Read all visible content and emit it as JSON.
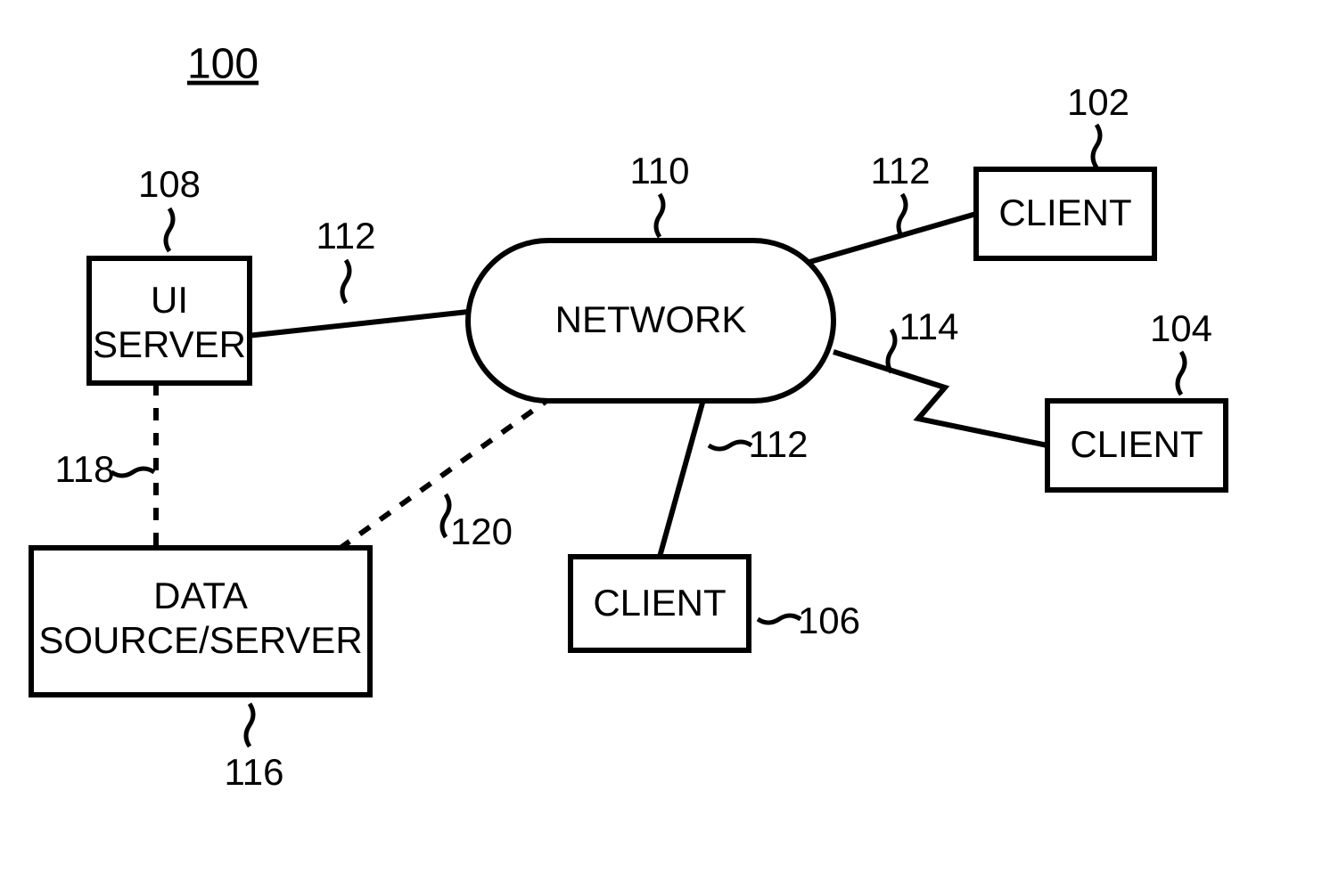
{
  "diagram": {
    "title_ref": "100",
    "network": {
      "label": "NETWORK",
      "ref": "110"
    },
    "ui_server": {
      "label_line1": "UI",
      "label_line2": "SERVER",
      "ref": "108"
    },
    "data_source": {
      "label_line1": "DATA",
      "label_line2": "SOURCE/SERVER",
      "ref": "116"
    },
    "client_top": {
      "label": "CLIENT",
      "ref": "102"
    },
    "client_right": {
      "label": "CLIENT",
      "ref": "104"
    },
    "client_bottom": {
      "label": "CLIENT",
      "ref": "106"
    },
    "link_ui_network": {
      "ref": "112"
    },
    "link_client_top": {
      "ref": "112"
    },
    "link_client_bottom": {
      "ref": "112"
    },
    "link_client_right": {
      "ref": "114"
    },
    "link_ui_datasource": {
      "ref": "118"
    },
    "link_network_datasource": {
      "ref": "120"
    }
  }
}
